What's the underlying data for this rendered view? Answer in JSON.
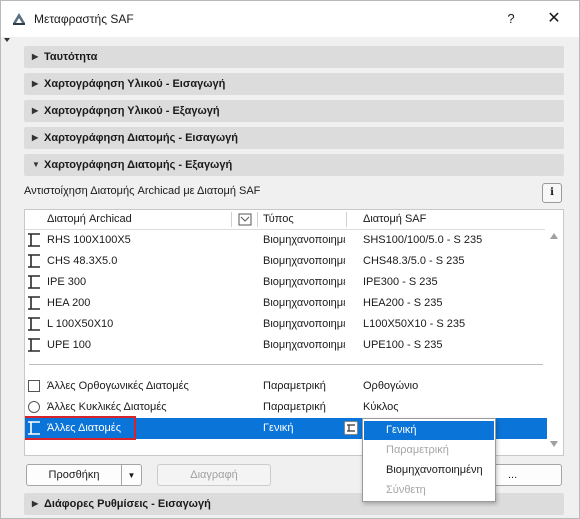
{
  "window": {
    "title": "Μεταφραστής SAF",
    "help_label": "?",
    "close_label": "✕"
  },
  "sections_top": [
    {
      "label": "Ταυτότητα",
      "expanded": false
    },
    {
      "label": "Χαρτογράφηση Υλικού - Εισαγωγή",
      "expanded": false
    },
    {
      "label": "Χαρτογράφηση Υλικού - Εξαγωγή",
      "expanded": false
    },
    {
      "label": "Χαρτογράφηση Διατομής - Εισαγωγή",
      "expanded": false
    },
    {
      "label": "Χαρτογράφηση Διατομής - Εξαγωγή",
      "expanded": true
    }
  ],
  "panel": {
    "subtitle": "Αντιστοίχηση Διατομής Archicad με Διατομή SAF",
    "info_label": "i"
  },
  "table": {
    "headers": {
      "archicad": "Διατομή Archicad",
      "type": "Τύπος",
      "saf": "Διατομή SAF"
    },
    "rows": [
      {
        "icon": "i-beam-icon",
        "archicad": "RHS 100X100X5",
        "type": "Βιομηχανοποιημένη",
        "saf": "SHS100/100/5.0 - S 235"
      },
      {
        "icon": "i-beam-icon",
        "archicad": "CHS 48.3X5.0",
        "type": "Βιομηχανοποιημένη",
        "saf": "CHS48.3/5.0 - S 235"
      },
      {
        "icon": "i-beam-icon",
        "archicad": "IPE 300",
        "type": "Βιομηχανοποιημένη",
        "saf": "IPE300 - S 235"
      },
      {
        "icon": "i-beam-icon",
        "archicad": "HEA 200",
        "type": "Βιομηχανοποιημένη",
        "saf": "HEA200 - S 235"
      },
      {
        "icon": "i-beam-icon",
        "archicad": "L 100X50X10",
        "type": "Βιομηχανοποιημένη",
        "saf": "L100X50X10 - S 235"
      },
      {
        "icon": "i-beam-icon",
        "archicad": "UPE 100",
        "type": "Βιομηχανοποιημένη",
        "saf": "UPE100 - S 235"
      }
    ],
    "other_rows": [
      {
        "icon": "rectangle-icon",
        "archicad": "Άλλες Ορθογωνικές Διατομές",
        "type": "Παραμετρική",
        "saf": "Ορθογώνιο"
      },
      {
        "icon": "circle-icon",
        "archicad": "Άλλες Κυκλικές Διατομές",
        "type": "Παραμετρική",
        "saf": "Κύκλος"
      },
      {
        "icon": "i-beam-icon",
        "archicad": "Άλλες Διατομές",
        "type": "Γενική",
        "saf": ""
      }
    ]
  },
  "dropdown": {
    "options": [
      {
        "label": "Γενική",
        "state": "selected"
      },
      {
        "label": "Παραμετρική",
        "state": "disabled"
      },
      {
        "label": "Βιομηχανοποιημένη",
        "state": "normal"
      },
      {
        "label": "Σύνθετη",
        "state": "disabled"
      }
    ]
  },
  "buttons": {
    "add_label": "Προσθήκη",
    "delete_label": "Διαγραφή",
    "more_label": "..."
  },
  "sections_bottom": [
    {
      "label": "Διάφορες Ρυθμίσεις - Εισαγωγή",
      "expanded": false
    }
  ],
  "colors": {
    "selection": "#0a74d8",
    "highlight_box": "#d9232b",
    "section_bg": "#dcdcdc"
  }
}
